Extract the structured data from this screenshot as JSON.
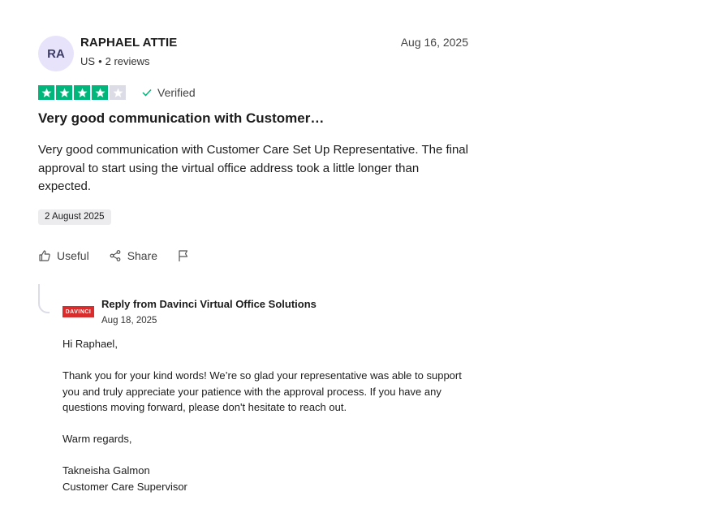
{
  "review": {
    "avatar_initials": "RA",
    "reviewer_name": "RAPHAEL ATTIE",
    "country": "US",
    "separator": "•",
    "review_count": "2 reviews",
    "date": "Aug 16, 2025",
    "rating": 4,
    "rating_max": 5,
    "verified_label": "Verified",
    "title": "Very good communication with Customer…",
    "body": "Very good communication with Customer Care Set Up Representative. The final approval to start using the virtual office address took a little longer than expected.",
    "experience_date": "2 August 2025",
    "actions": {
      "useful": "Useful",
      "share": "Share"
    }
  },
  "reply": {
    "logo_text": "DAVINCI",
    "from": "Reply from Davinci Virtual Office Solutions",
    "date": "Aug 18, 2025",
    "greeting": "Hi Raphael,",
    "paragraph": "Thank you for your kind words! We’re so glad your representative was able to support you and truly appreciate your patience with the approval process. If you have any questions moving forward, please don't hesitate to reach out.",
    "closing": "Warm regards,",
    "signature_name": "Takneisha Galmon",
    "signature_title": "Customer Care Supervisor"
  },
  "colors": {
    "star_on": "#00b67a",
    "star_off": "#dcdce6",
    "avatar_bg": "#e6e3fb",
    "logo_red": "#d92c2c"
  }
}
